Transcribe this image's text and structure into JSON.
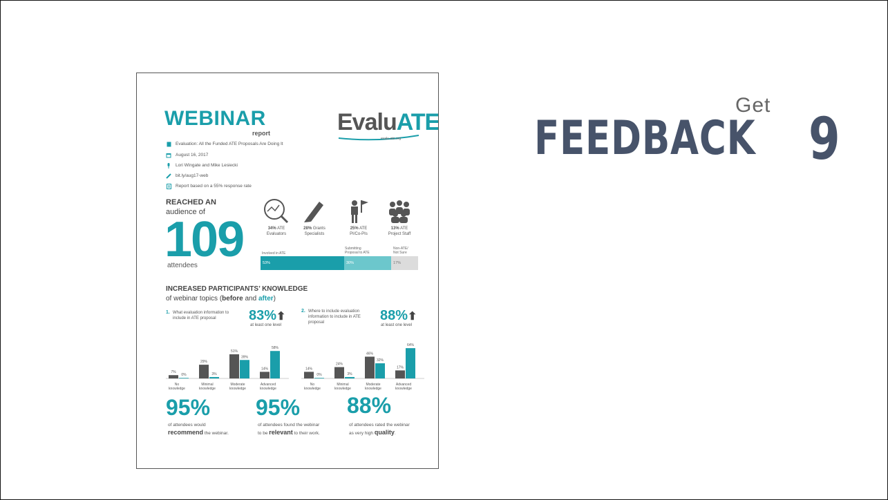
{
  "slide": {
    "heading_small": "Get",
    "heading_big": "FEEDBACK",
    "step_number": "9"
  },
  "report": {
    "title": "WEBINAR",
    "subtitle": "report",
    "logo_text_a": "Evalu",
    "logo_text_b": "ATE",
    "logo_url": "evalu-ate.org",
    "meta": [
      {
        "icon": "book-icon",
        "text": "Evaluation: All the Funded ATE Proposals Are Doing It"
      },
      {
        "icon": "calendar-icon",
        "text": "August 16, 2017"
      },
      {
        "icon": "microphone-icon",
        "text": "Lori Wingate and Mike Lesiecki"
      },
      {
        "icon": "link-icon",
        "text": "bit.ly/aug17-web"
      },
      {
        "icon": "clipboard-icon",
        "text": "Report based on a 55% response rate"
      }
    ],
    "reach": {
      "heading": "REACHED AN",
      "audience_of": "audience of",
      "count": "109",
      "attendees": "attendees"
    },
    "audience_types": [
      {
        "icon": "evaluator-chart-icon",
        "pct": "34%",
        "label_a": "ATE",
        "label_b": "Evaluators"
      },
      {
        "icon": "pen-icon",
        "pct": "28%",
        "label_a": "Grants",
        "label_b": "Specialists"
      },
      {
        "icon": "person-flag-icon",
        "pct": "25%",
        "label_a": "ATE",
        "label_b": "PI/Co-PIs"
      },
      {
        "icon": "group-icon",
        "pct": "13%",
        "label_a": "ATE",
        "label_b": "Project Staff"
      }
    ],
    "involvement": [
      {
        "label_a": "Involved in ATE",
        "label_b": "",
        "value": "53%",
        "fraction": 0.53,
        "color": "#1a9eaa"
      },
      {
        "label_a": "Submitting",
        "label_b": "Proposal to ATE",
        "value": "30%",
        "fraction": 0.3,
        "color": "#6cc7cc"
      },
      {
        "label_a": "Non-ATE/",
        "label_b": "Not Sure",
        "value": "17%",
        "fraction": 0.17,
        "color": "#dcdcdc"
      }
    ],
    "knowledge": {
      "title": "INCREASED PARTICIPANTS’ KNOWLEDGE",
      "sub_pre": "of webinar topics (",
      "before": "before",
      "and": " and ",
      "after": "after",
      "sub_post": ")"
    },
    "questions": [
      {
        "num": "1.",
        "text_a": "What evaluation information to",
        "text_b": "include in ATE proposal",
        "text_c": "",
        "pct": "83%",
        "sub": "at least one level"
      },
      {
        "num": "2.",
        "text_a": "Where to include evaluation",
        "text_b": "information to include in ATE",
        "text_c": "proposal",
        "pct": "88%",
        "sub": "at least one level"
      }
    ],
    "stats": [
      {
        "value": "95%",
        "line_a": "of attendees would",
        "bold": "recommend",
        "line_b": "the webinar.",
        "pre_b": ""
      },
      {
        "value": "95%",
        "line_a": "of attendees found the webinar",
        "pre_b": "to be",
        "bold": "relevant",
        "line_b": "to their work."
      },
      {
        "value": "88%",
        "line_a": "of attendees rated the webinar",
        "pre_b": "as very high",
        "bold": "quality",
        "line_b": "."
      }
    ]
  },
  "chart_data": [
    {
      "type": "bar",
      "categories": [
        "No knowledge",
        "Minimal knowledge",
        "Moderate knowledge",
        "Advanced knowledge"
      ],
      "series": [
        {
          "name": "before",
          "values": [
            7,
            29,
            51,
            14
          ]
        },
        {
          "name": "after",
          "values": [
            0,
            3,
            39,
            58
          ]
        }
      ],
      "value_labels": {
        "before": [
          "7%",
          "29%",
          "51%",
          "14%"
        ],
        "after": [
          "0%",
          "3%",
          "39%",
          "58%"
        ]
      },
      "ylim": [
        0,
        70
      ],
      "colors": {
        "before": "#555555",
        "after": "#1a9eaa"
      }
    },
    {
      "type": "bar",
      "categories": [
        "No knowledge",
        "Minimal knowledge",
        "Moderate knowledge",
        "Advanced knowledge"
      ],
      "series": [
        {
          "name": "before",
          "values": [
            14,
            24,
            46,
            17
          ]
        },
        {
          "name": "after",
          "values": [
            0,
            3,
            32,
            64
          ]
        }
      ],
      "value_labels": {
        "before": [
          "14%",
          "24%",
          "46%",
          "17%"
        ],
        "after": [
          "0%",
          "3%",
          "32%",
          "64%"
        ]
      },
      "ylim": [
        0,
        70
      ],
      "colors": {
        "before": "#555555",
        "after": "#1a9eaa"
      }
    }
  ]
}
